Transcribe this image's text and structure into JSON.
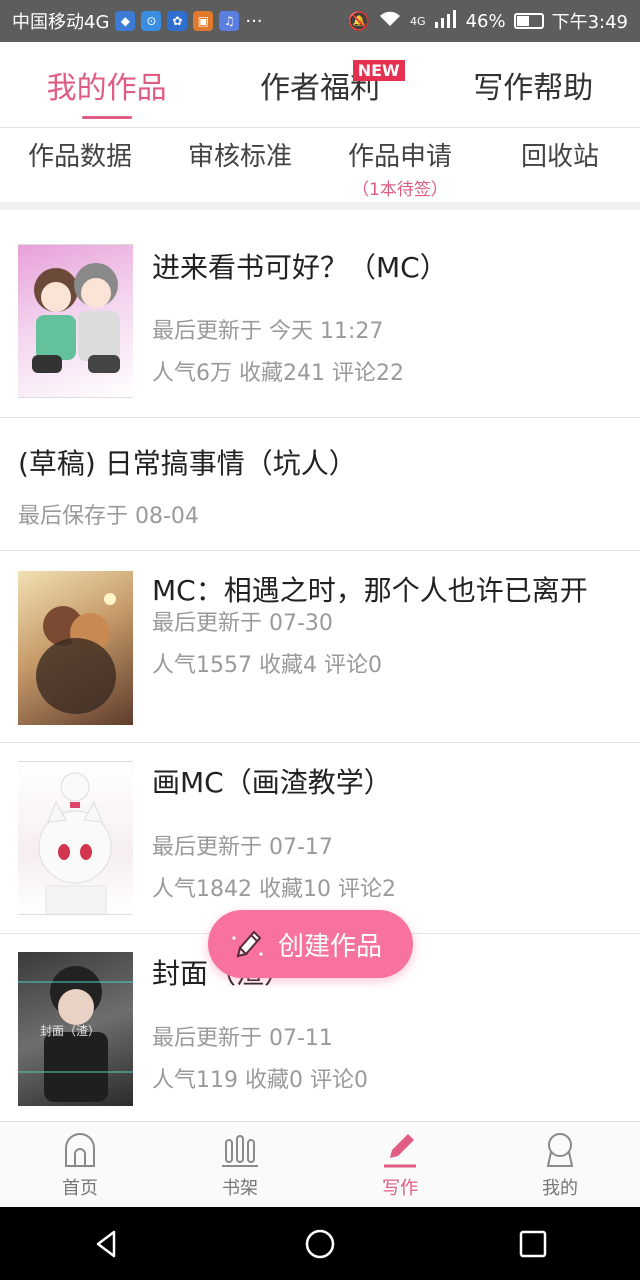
{
  "status_bar": {
    "carrier": "中国移动4G",
    "more": "···",
    "signal_label": "4G",
    "battery": "46%",
    "time": "下午3:49"
  },
  "tabs": [
    {
      "label": "我的作品",
      "active": true
    },
    {
      "label": "作者福利",
      "badge": "NEW"
    },
    {
      "label": "写作帮助"
    }
  ],
  "subnav": [
    {
      "label": "作品数据"
    },
    {
      "label": "审核标准"
    },
    {
      "label": "作品申请",
      "note": "（1本待签）"
    },
    {
      "label": "回收站"
    }
  ],
  "works": [
    {
      "title": "进来看书可好？（MC）",
      "updated": "最后更新于 今天 11:27",
      "stats": "人气6万  收藏241  评论22"
    },
    {
      "title": "(草稿) 日常搞事情（坑人）",
      "updated": "最后保存于 08-04"
    },
    {
      "title": "MC：相遇之时，那个人也许已离开",
      "updated": "最后更新于 07-30",
      "stats": "人气1557  收藏4  评论0"
    },
    {
      "title": "画MC（画渣教学）",
      "updated": "最后更新于 07-17",
      "stats": "人气1842  收藏10  评论2"
    },
    {
      "title": "封面（渣）",
      "updated": "最后更新于 07-11",
      "stats": "人气119  收藏0  评论0",
      "cover_text": "封面（渣）"
    }
  ],
  "fab": {
    "label": "创建作品"
  },
  "bottom_nav": [
    {
      "label": "首页",
      "icon": "home-icon"
    },
    {
      "label": "书架",
      "icon": "bookshelf-icon"
    },
    {
      "label": "写作",
      "icon": "pen-icon",
      "active": true
    },
    {
      "label": "我的",
      "icon": "profile-icon"
    }
  ],
  "colors": {
    "accent": "#e05c83",
    "fab": "#f7739d",
    "badge": "#e5304f"
  }
}
